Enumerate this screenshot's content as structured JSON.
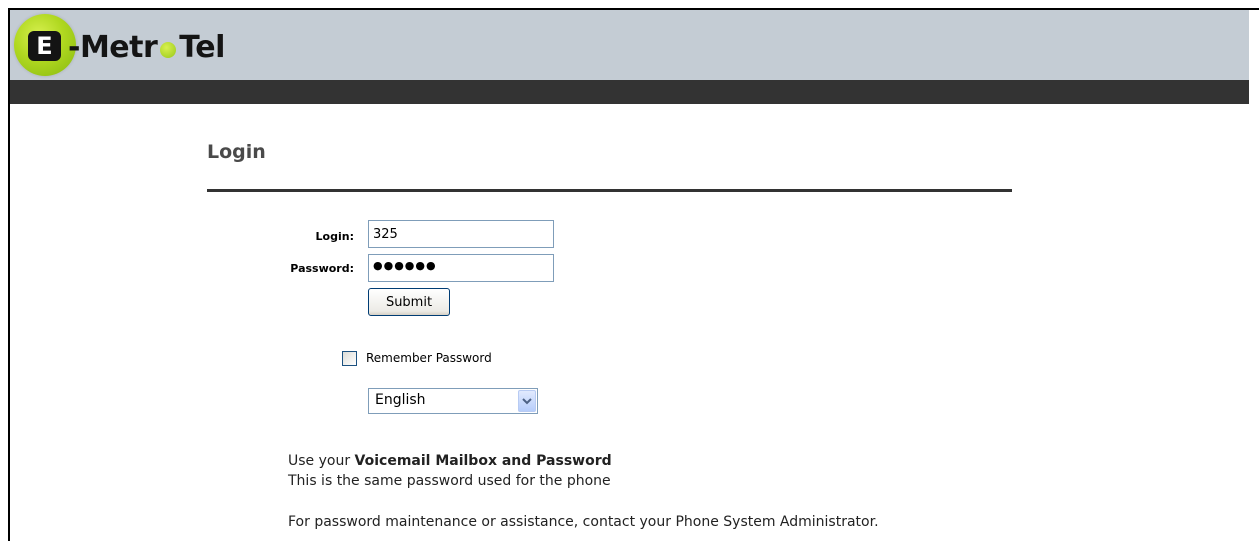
{
  "brand": {
    "logo_letter": "E",
    "logo_text_before": "-Metr",
    "logo_text_after": "Tel",
    "accent_color": "#b0d820",
    "header_color": "#c4ccd4",
    "bar_color": "#333333"
  },
  "page": {
    "title": "Login"
  },
  "form": {
    "login_label": "Login:",
    "login_value": "325",
    "password_label": "Password:",
    "password_value": "●●●●●●",
    "submit_label": "Submit",
    "remember_label": "Remember Password",
    "remember_checked": false,
    "language_selected": "English"
  },
  "info": {
    "line1_prefix": "Use your ",
    "line1_bold": "Voicemail Mailbox and Password",
    "line2": "This is the same password used for the phone",
    "line3": "For password maintenance or assistance, contact your Phone System Administrator."
  },
  "icons": {
    "dropdown": "chevron-down-icon",
    "checkbox": "checkbox-icon"
  }
}
